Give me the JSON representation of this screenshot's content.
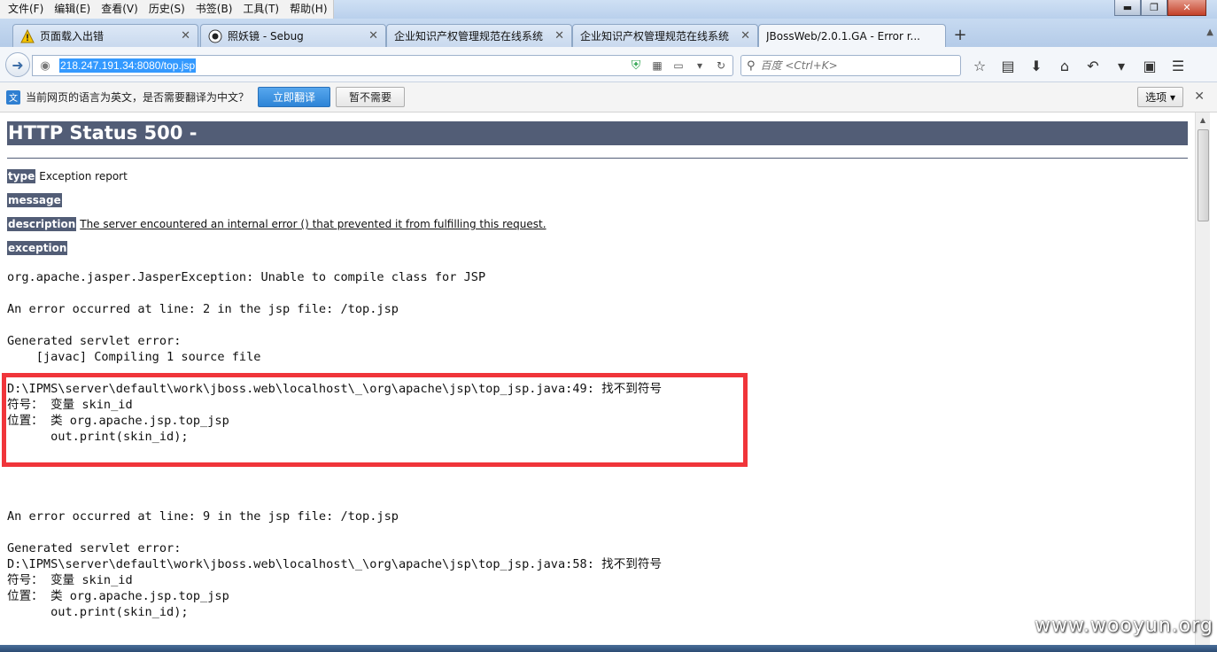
{
  "menu": [
    "文件(F)",
    "编辑(E)",
    "查看(V)",
    "历史(S)",
    "书签(B)",
    "工具(T)",
    "帮助(H)"
  ],
  "window_controls": {
    "minimize": "▬",
    "restore": "❐",
    "close": "✕"
  },
  "tabs": [
    {
      "label": "页面载入出错",
      "icon": "warning-icon"
    },
    {
      "label": "照妖镜 - Sebug",
      "icon": "sebug-icon"
    },
    {
      "label": "企业知识产权管理规范在线系统",
      "icon": ""
    },
    {
      "label": "企业知识产权管理规范在线系统",
      "icon": ""
    },
    {
      "label": "JBossWeb/2.0.1.GA - Error r...",
      "icon": ""
    }
  ],
  "nav": {
    "url": "218.247.191.34:8080/top.jsp",
    "search_placeholder": "百度 <Ctrl+K>"
  },
  "translate_bar": {
    "message": "当前网页的语言为英文，是否需要翻译为中文？",
    "translate_button": "立即翻译",
    "dismiss_button": "暂不需要",
    "options_button": "选项"
  },
  "page": {
    "title": "HTTP Status 500 -",
    "type_label": "type",
    "type_value": "Exception report",
    "message_label": "message",
    "description_label": "description",
    "description_value": "The server encountered an internal error () that prevented it from fulfilling this request.",
    "exception_label": "exception",
    "exception_line": "org.apache.jasper.JasperException: Unable to compile class for JSP",
    "error1_line": "An error occurred at line: 2 in the jsp file: /top.jsp",
    "generated1": "Generated servlet error:",
    "javac_line": "    [javac] Compiling 1 source file",
    "block1": [
      "D:\\IPMS\\server\\default\\work\\jboss.web\\localhost\\_\\org\\apache\\jsp\\top_jsp.java:49: 找不到符号",
      "符号： 变量 skin_id",
      "位置： 类 org.apache.jsp.top_jsp",
      "      out.print(skin_id);"
    ],
    "error2_line": "An error occurred at line: 9 in the jsp file: /top.jsp",
    "generated2": "Generated servlet error:",
    "block2": [
      "D:\\IPMS\\server\\default\\work\\jboss.web\\localhost\\_\\org\\apache\\jsp\\top_jsp.java:58: 找不到符号",
      "符号： 变量 skin_id",
      "位置： 类 org.apache.jsp.top_jsp",
      "      out.print(skin_id);"
    ]
  },
  "watermark": "www.wooyun.org",
  "colors": {
    "header_bg": "#525d76",
    "highlight_box": "#f0353a",
    "url_selection": "#3399ff"
  }
}
